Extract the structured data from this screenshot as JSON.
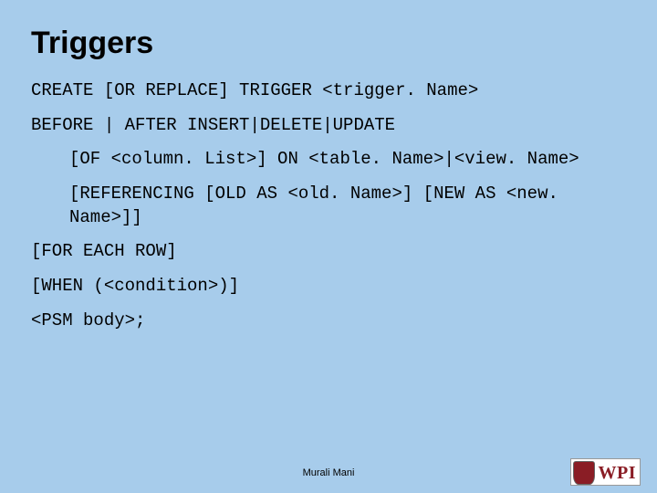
{
  "title": "Triggers",
  "lines": {
    "l1": "CREATE [OR REPLACE] TRIGGER <trigger. Name>",
    "l2": "BEFORE | AFTER  INSERT|DELETE|UPDATE",
    "l3": "[OF <column. List>] ON <table. Name>|<view. Name>",
    "l4": "[REFERENCING [OLD AS <old. Name>] [NEW AS <new. Name>]]",
    "l5": "[FOR EACH ROW]",
    "l6": "[WHEN (<condition>)]",
    "l7": "<PSM body>;"
  },
  "footer": "Murali Mani",
  "logo_text": "WPI"
}
